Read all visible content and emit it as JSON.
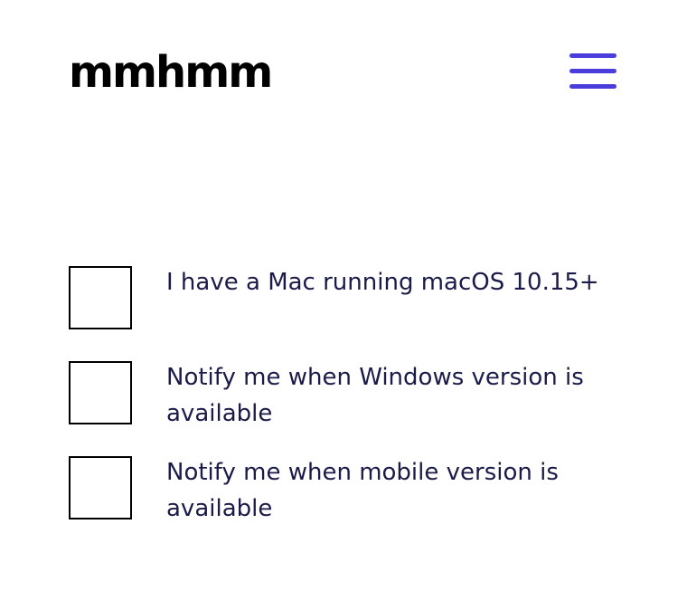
{
  "header": {
    "logo_text": "mmhmm",
    "menu_icon": "hamburger-icon",
    "accent_color": "#4a3ddb"
  },
  "options": [
    {
      "label": "I have a Mac running macOS 10.15+",
      "checked": false
    },
    {
      "label": "Notify me when Windows version is available",
      "checked": false
    },
    {
      "label": "Notify me when mobile version is available",
      "checked": false
    }
  ]
}
